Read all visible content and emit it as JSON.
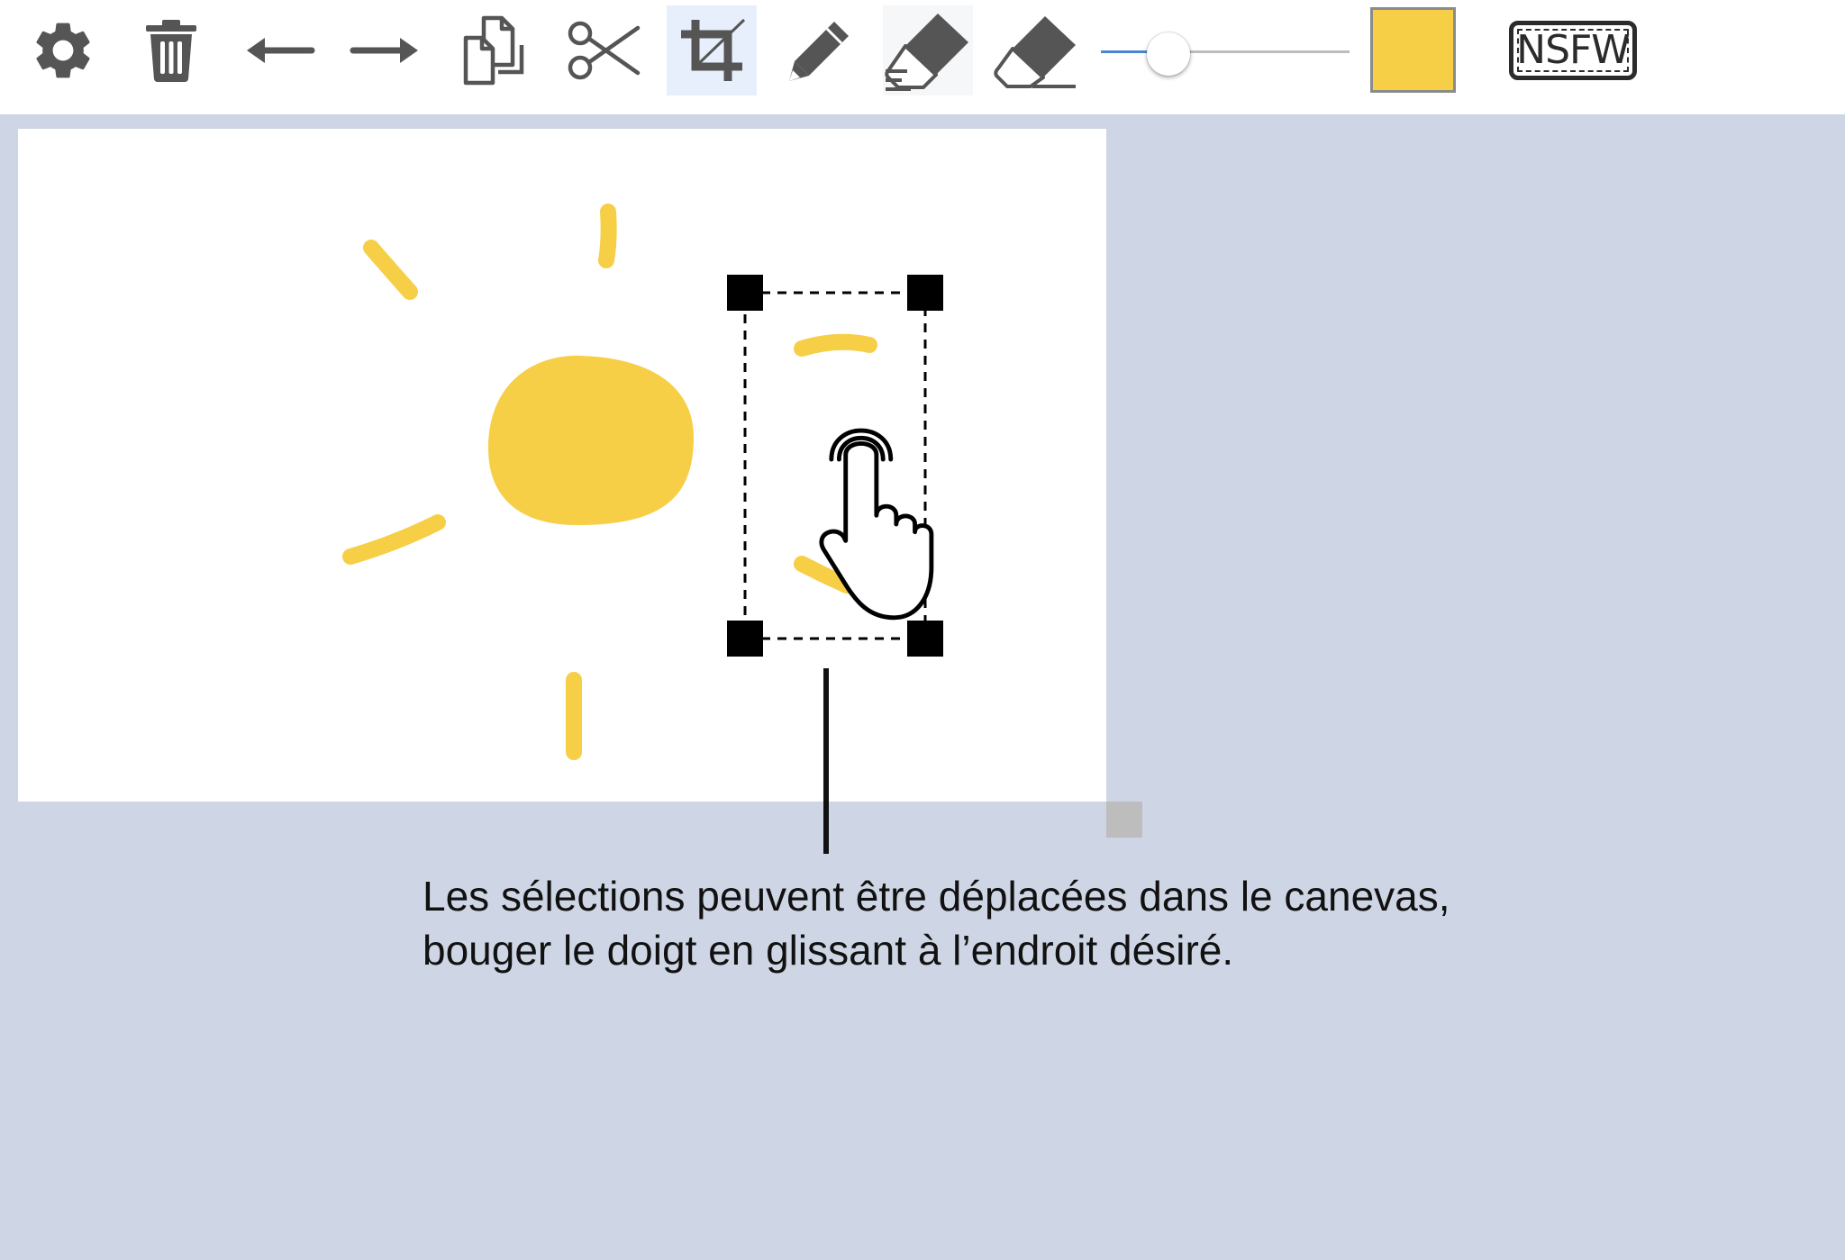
{
  "toolbar": {
    "tools": [
      {
        "name": "settings",
        "icon": "gear-icon"
      },
      {
        "name": "delete",
        "icon": "trash-icon"
      },
      {
        "name": "undo",
        "icon": "arrow-left-icon"
      },
      {
        "name": "redo",
        "icon": "arrow-right-icon"
      },
      {
        "name": "copy",
        "icon": "copy-icon"
      },
      {
        "name": "cut",
        "icon": "scissors-icon"
      },
      {
        "name": "select",
        "icon": "crop-select-icon",
        "active": true
      },
      {
        "name": "pencil",
        "icon": "pencil-icon"
      },
      {
        "name": "smudge-eraser",
        "icon": "eraser-lines-icon"
      },
      {
        "name": "eraser",
        "icon": "eraser-icon"
      }
    ],
    "brush_size_fraction": 0.27,
    "current_color": "#f6cf47",
    "nsfw_label": "NSFW"
  },
  "canvas": {
    "stroke_color": "#f6cf47",
    "selection": {
      "dashed": true,
      "handles": 4
    }
  },
  "gesture_icon": "hand-pointer-icon",
  "hint": {
    "line1": "Les sélections peuvent être déplacées dans le canevas,",
    "line2": "bouger le doigt en glissant à l’endroit désiré."
  },
  "colors": {
    "background": "#ced5e4",
    "toolbar_bg": "#ffffff",
    "icon": "#555555",
    "active_tool_bg": "#e8effc",
    "slider_fill": "#4a86d0"
  }
}
